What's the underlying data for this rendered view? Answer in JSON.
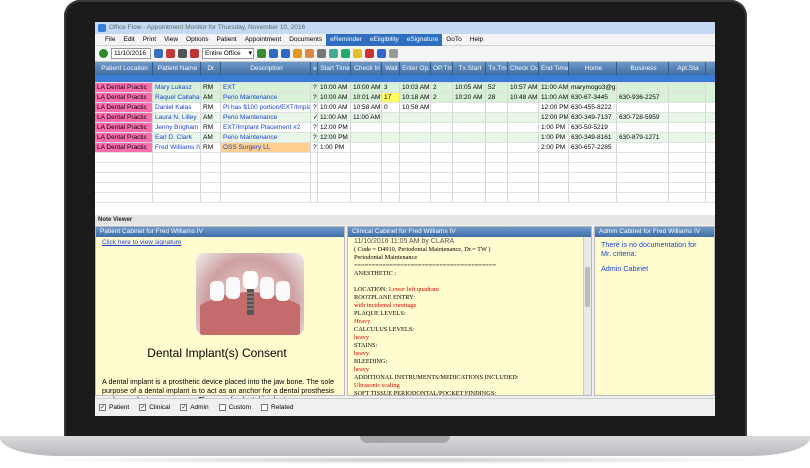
{
  "window": {
    "title": "Office Flow - Appointment Monitor for Thursday, November 10, 2016"
  },
  "menu": [
    "File",
    "Edit",
    "Print",
    "View",
    "Options",
    "Patient",
    "Appointment",
    "Documents",
    "eReminder",
    "eEligibility",
    "eSignature",
    "GoTo",
    "Help"
  ],
  "toolbar": {
    "date": "11/10/2016",
    "office": "Entire Office"
  },
  "columns": [
    "Patient Location",
    "Patient Name",
    "Dr.",
    "Description",
    "e",
    "Start Time",
    "Check In",
    "Wait",
    "Enter Op.",
    "OP.Tm",
    "Tx.Start",
    "Tx.Tm",
    "Check Out",
    "End Time",
    "Home",
    "Business",
    "Apt.Sta"
  ],
  "rows": [
    {
      "loc": "LA Dental Practic",
      "name": "Mary Lukasz",
      "dr": "RM",
      "desc": "EXT",
      "e": "?",
      "start": "10:00 AM",
      "checkin": "10:00 AM",
      "wait": "3",
      "enter": "10:03 AM",
      "op": "2",
      "txstart": "10:05 AM",
      "txtm": "52",
      "checkout": "10:57 AM",
      "end": "11:00 AM",
      "home": "marymogo3@g",
      "business": ""
    },
    {
      "loc": "LA Dental Practic",
      "name": "Raquel Callahan",
      "dr": "AM",
      "desc": "Perio Maintenance",
      "e": "?",
      "start": "10:00 AM",
      "checkin": "10:01 AM",
      "wait": "17",
      "enter": "10:18 AM",
      "op": "2",
      "txstart": "10:20 AM",
      "txtm": "28",
      "checkout": "10:48 AM",
      "end": "11:00 AM",
      "home": "630-67-3445",
      "business": "630-936-2257"
    },
    {
      "loc": "LA Dental Practic",
      "name": "Daniel Kalas",
      "dr": "RM",
      "desc": "Pt has $100 portion/EXT/Impla",
      "e": "?",
      "start": "10:00 AM",
      "checkin": "10:58 AM",
      "wait": "0",
      "enter": "10:58 AM",
      "op": "",
      "txstart": "",
      "txtm": "",
      "checkout": "",
      "end": "12:00 PM",
      "home": "630-455-8222",
      "business": ""
    },
    {
      "loc": "LA Dental Practic",
      "name": "Laura N. Lilley",
      "dr": "AM",
      "desc": "Perio Maintenance",
      "e": "✓",
      "start": "11:00 AM",
      "checkin": "11:00 AM",
      "wait": "",
      "enter": "",
      "op": "",
      "txstart": "",
      "txtm": "",
      "checkout": "",
      "end": "12:00 PM",
      "home": "630-349-7137",
      "business": "630-728-5959"
    },
    {
      "loc": "LA Dental Practic",
      "name": "Jenny Brigham",
      "dr": "RM",
      "desc": "EXT/Implant Placement #2",
      "e": "?",
      "start": "12:00 PM",
      "checkin": "",
      "wait": "",
      "enter": "",
      "op": "",
      "txstart": "",
      "txtm": "",
      "checkout": "",
      "end": "1:00 PM",
      "home": "630-50-5219",
      "business": ""
    },
    {
      "loc": "LA Dental Practic",
      "name": "Earl D. Clark",
      "dr": "AM",
      "desc": "Perio Maintenance",
      "e": "?",
      "start": "12:00 PM",
      "checkin": "",
      "wait": "",
      "enter": "",
      "op": "",
      "txstart": "",
      "txtm": "",
      "checkout": "",
      "end": "1:00 PM",
      "home": "630-349-8161",
      "business": "630-879-1271"
    },
    {
      "loc": "LA Dental Practic",
      "name": "Fred Williams IV",
      "dr": "RM",
      "desc": "OSS Surgery LL",
      "e": "?",
      "start": "1:00 PM",
      "checkin": "",
      "wait": "",
      "enter": "",
      "op": "",
      "txstart": "",
      "txtm": "",
      "checkout": "",
      "end": "2:00 PM",
      "home": "630-657-2285",
      "business": ""
    }
  ],
  "note_viewer": {
    "title": "Note Viewer",
    "patient": {
      "header": "Patient Cabinet for Fred Williams IV",
      "link": "Click here to view signature",
      "heading": "Dental Implant(s) Consent",
      "body": "A dental implant is a prosthetic device placed into the jaw bone. The sole purpose of a dental implant is to act as an anchor for a dental prosthesis such as a denture or a crown. The use of a dental implant"
    },
    "clinical": {
      "header": "Clinical Cabinet for Fred Williams IV",
      "stamp": "11/10/2016 11:05 AM by CLARA",
      "lines": [
        {
          "t": "( Code = D4910, Periodontal Maintenance, Dr.= TW )",
          "red": false
        },
        {
          "t": "Periodontal Maintenance",
          "red": false
        },
        {
          "t": "========================================",
          "red": false
        },
        {
          "t": "ANESTHETIC :",
          "red": false
        },
        {
          "t": "",
          "red": false
        },
        {
          "t": "LOCATION:   Lower left quadrant",
          "red": false,
          "redpart": "Lower left quadrant"
        },
        {
          "t": "ROOTPLANE ENTRY:",
          "red": false
        },
        {
          "t": "with incidental curettage",
          "red": true
        },
        {
          "t": "PLAQUE LEVELS:",
          "red": false
        },
        {
          "t": "Heavy",
          "red": true
        },
        {
          "t": "CALCULUS LEVELS:",
          "red": false
        },
        {
          "t": "heavy",
          "red": true
        },
        {
          "t": "STAINS:",
          "red": false
        },
        {
          "t": "heavy.",
          "red": true
        },
        {
          "t": "BLEEDING:",
          "red": false
        },
        {
          "t": "heavy",
          "red": true
        },
        {
          "t": "ADDITIONAL INSTRUMENTS/MEDICATIONS INCLUDED:",
          "red": false
        },
        {
          "t": " Ultrasonic scaling",
          "red": true
        },
        {
          "t": "SOFT TISSUE PERIODONTAL/POCKET FINDINGS:",
          "red": false
        }
      ]
    },
    "admin": {
      "header": "Admin Cabinet for Fred Williams IV",
      "msg": "There is no documentation for Mr. criteria:",
      "link": "Admin Cabinet"
    }
  },
  "filters": [
    {
      "label": "Patient",
      "checked": true
    },
    {
      "label": "Clinical",
      "checked": true
    },
    {
      "label": "Admin",
      "checked": true
    },
    {
      "label": "Custom",
      "checked": false
    },
    {
      "label": "Related",
      "checked": false
    }
  ]
}
